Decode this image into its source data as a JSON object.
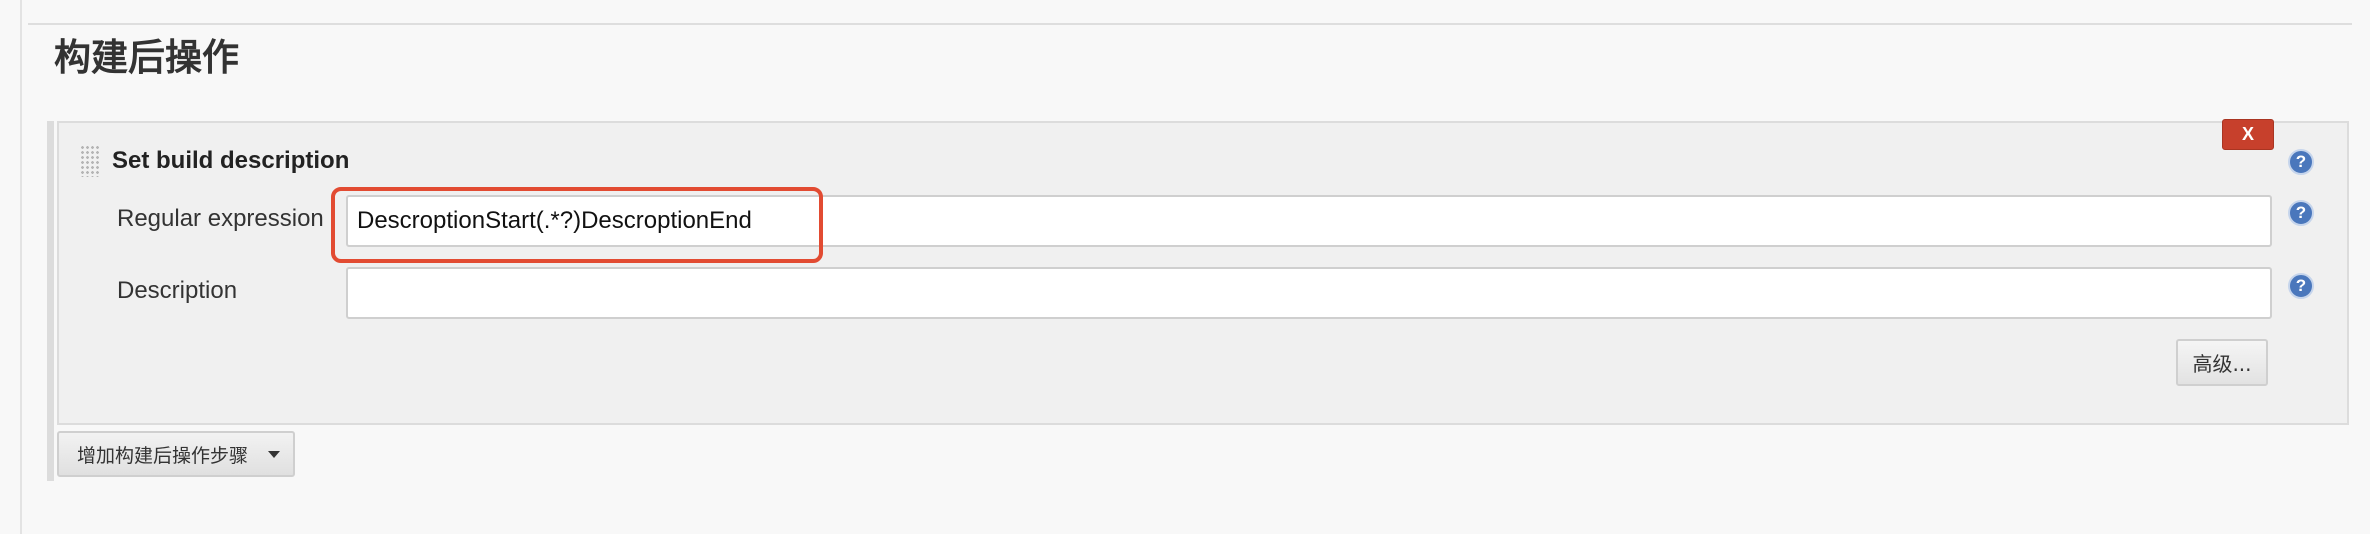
{
  "section": {
    "title": "构建后操作"
  },
  "step": {
    "title": "Set build description",
    "delete_label": "X",
    "help_label": "?",
    "fields": [
      {
        "label": "Regular expression",
        "value": "DescroptionStart(.*?)DescroptionEnd"
      },
      {
        "label": "Description",
        "value": ""
      }
    ],
    "advanced_label": "高级..."
  },
  "add_step": {
    "label": "增加构建后操作步骤"
  },
  "colors": {
    "highlight": "#e24b32",
    "delete_button": "#c7402c",
    "help_icon": "#4a77bc"
  },
  "icons": {
    "help": "help-icon",
    "delete": "close-icon",
    "drag": "drag-handle-icon",
    "dropdown": "caret-down-icon"
  }
}
